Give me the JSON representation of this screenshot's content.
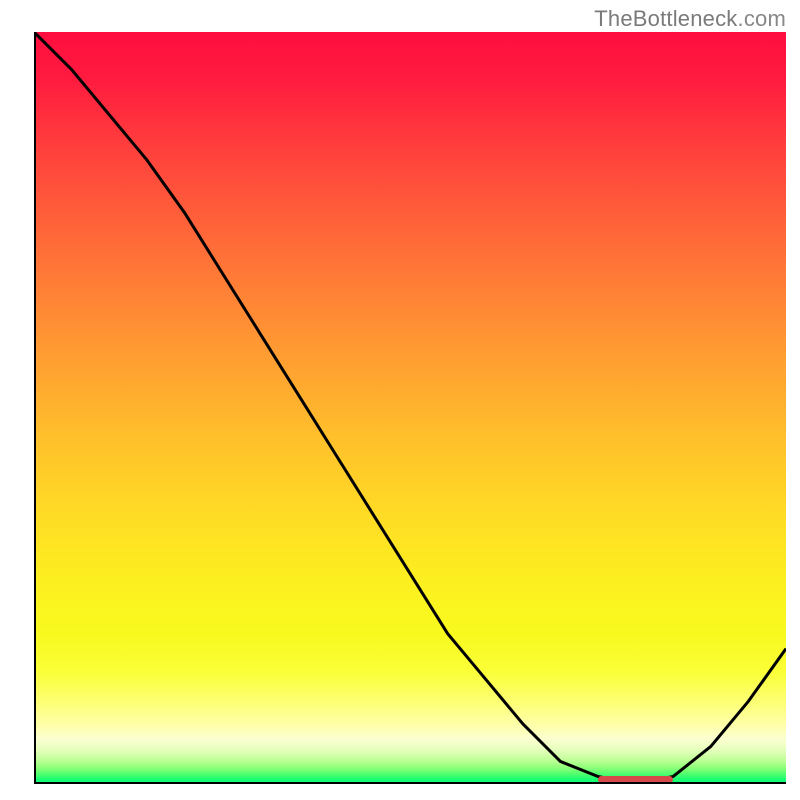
{
  "attribution": {
    "brand": "TheBottleneck",
    "suffix": ".com"
  },
  "colors": {
    "curve": "#000000",
    "marker": "#d64a4a",
    "gradient_top": "#ff0e3f",
    "gradient_bottom": "#00ff73"
  },
  "chart_data": {
    "type": "line",
    "title": "",
    "xlabel": "",
    "ylabel": "",
    "xlim": [
      0,
      100
    ],
    "ylim": [
      0,
      100
    ],
    "x": [
      0,
      5,
      10,
      15,
      20,
      25,
      30,
      35,
      40,
      45,
      50,
      55,
      60,
      65,
      70,
      75,
      80,
      85,
      90,
      95,
      100
    ],
    "values": [
      100,
      95,
      89,
      83,
      76,
      68,
      60,
      52,
      44,
      36,
      28,
      20,
      14,
      8,
      3,
      1,
      0,
      1,
      5,
      11,
      18
    ],
    "min_marker": {
      "x_start": 75,
      "x_end": 85,
      "y": 0.7
    },
    "notes": "Values read off a gradient-backed curve; y=0 at bottom (green), y=100 at top (red). The curve drops steeply from top-left, bottoms out near x≈80, then rises toward the right edge."
  }
}
